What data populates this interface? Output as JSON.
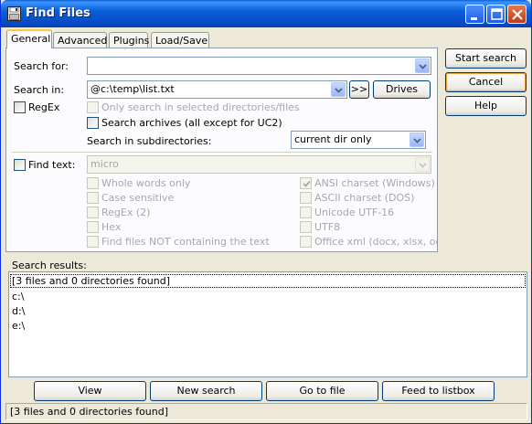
{
  "window": {
    "title": "Find Files"
  },
  "tabs": [
    "General",
    "Advanced",
    "Plugins",
    "Load/Save"
  ],
  "general": {
    "search_for_label": "Search for:",
    "search_for_value": "",
    "search_in_label": "Search in:",
    "search_in_value": "@c:\\temp\\list.txt",
    "browse_label": ">>",
    "drives_label": "Drives",
    "regex_label": "RegEx",
    "only_selected_label": "Only search in selected directories/files",
    "search_archives_label": "Search archives (all except for UC2)",
    "subdirs_label": "Search in subdirectories:",
    "subdirs_value": "current dir only",
    "find_text_label": "Find text:",
    "find_text_value": "micro",
    "options_left": [
      "Whole words only",
      "Case sensitive",
      "RegEx (2)",
      "Hex",
      "Find files NOT containing the text"
    ],
    "options_right": [
      "ANSI charset (Windows)",
      "ASCII charset (DOS)",
      "Unicode UTF-16",
      "UTF8",
      "Office xml (docx, xlsx, odt etc"
    ]
  },
  "side_buttons": {
    "start": "Start search",
    "cancel": "Cancel",
    "help": "Help"
  },
  "results": {
    "label": "Search results:",
    "items": [
      "[3 files and 0 directories found]",
      "c:\\",
      "d:\\",
      "e:\\"
    ]
  },
  "bottom_buttons": [
    "View",
    "New search",
    "Go to file",
    "Feed to listbox"
  ],
  "status": "[3 files and 0 directories found]"
}
